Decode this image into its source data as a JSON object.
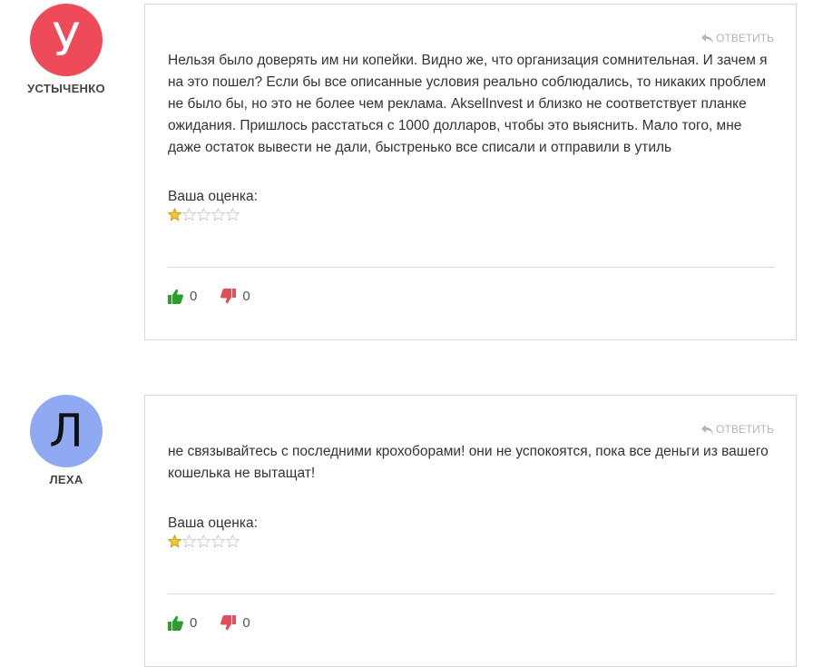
{
  "reply_label": "ОТВЕТИТЬ",
  "rating_label": "Ваша оценка:",
  "colors": {
    "like": "#2e9e2e",
    "dislike": "#e0505a",
    "star_filled": "#f2c531",
    "star_empty": "#ffffff"
  },
  "comments": [
    {
      "author": "УСТЫЧЕНКО",
      "avatar_letter": "У",
      "avatar_color": "#ee4a5a",
      "text": "Нельзя было доверять им ни копейки. Видно же, что организация сомнительная. И зачем я на это пошел? Если бы все описанные условия реально соблюдались, то никаких проблем не было бы, но это не более чем реклама. AkselInvest и близко не соответствует планке ожидания. Пришлось расстаться с 1000 долларов, чтобы это выяснить. Мало того, мне даже остаток вывести не дали, быстренько все списали и отправили в утиль",
      "rating": 1,
      "rating_max": 5,
      "likes": "0",
      "dislikes": "0"
    },
    {
      "author": "ЛЕХА",
      "avatar_letter": "Л",
      "avatar_color": "#8fa9f3",
      "text": "не связывайтесь с последними крохоборами! они не успокоятся, пока все деньги из вашего кошелька не вытащат!",
      "rating": 1,
      "rating_max": 5,
      "likes": "0",
      "dislikes": "0"
    }
  ]
}
